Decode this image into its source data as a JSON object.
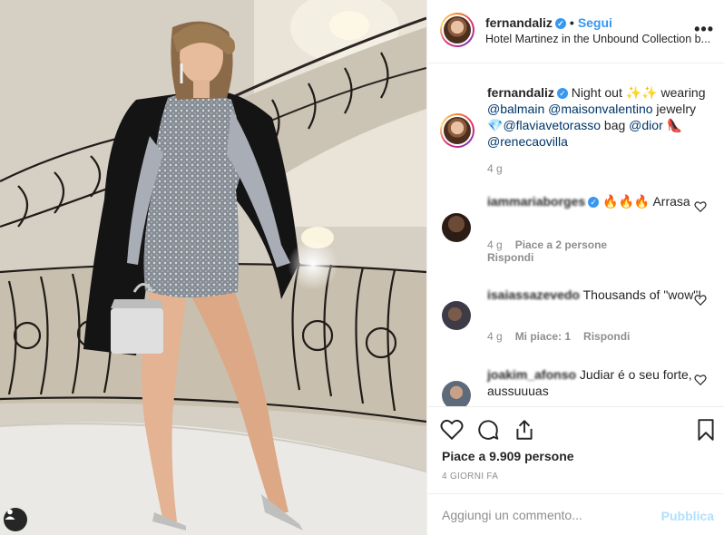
{
  "post": {
    "author": "fernandaliz",
    "verified_icon": "verified-badge-icon",
    "follow_label": "Segui",
    "separator": "•",
    "location": "Hotel Martinez in the Unbound Collection b...",
    "more_icon": "more-options-icon",
    "more_label": "•••"
  },
  "caption": {
    "user": "fernandaliz",
    "segments": [
      {
        "text": " Night out ✨✨ wearing ",
        "type": "text"
      },
      {
        "text": "@balmain",
        "type": "mention"
      },
      {
        "text": " ",
        "type": "text"
      },
      {
        "text": "@maisonvalentino",
        "type": "mention"
      },
      {
        "text": " jewelry 💎",
        "type": "text"
      },
      {
        "text": "@flaviavetorasso",
        "type": "mention"
      },
      {
        "text": " bag ",
        "type": "text"
      },
      {
        "text": "@dior",
        "type": "mention"
      },
      {
        "text": " 👠 ",
        "type": "text"
      },
      {
        "text": "@renecaovilla",
        "type": "mention"
      }
    ],
    "age": "4 g"
  },
  "comments": [
    {
      "user": "iammariaborges",
      "verified": true,
      "text": " 🔥🔥🔥 Arrasa",
      "age": "4 g",
      "likes_label": "Piace a 2 persone",
      "reply_label": "Rispondi"
    },
    {
      "user": "isaiassazevedo",
      "verified": false,
      "text": " Thousands of \"wow\"!",
      "age": "4 g",
      "likes_label": "Mi piace: 1",
      "reply_label": "Rispondi"
    },
    {
      "user": "joakim_afonso",
      "verified": false,
      "text": " Judiar é o seu forte, aussuuuas",
      "age": "",
      "likes_label": "",
      "reply_label": ""
    }
  ],
  "actions": {
    "like_icon": "heart-icon",
    "comment_icon": "comment-bubble-icon",
    "share_icon": "share-icon",
    "save_icon": "bookmark-icon",
    "likes_text": "Piace a 9.909 persone",
    "timestamp": "4 GIORNI FA"
  },
  "composer": {
    "placeholder": "Aggiungi un commento...",
    "publish_label": "Pubblica"
  },
  "colors": {
    "link_blue": "#3897f0",
    "mention_blue": "#003569",
    "publish_disabled": "#b2dffc",
    "muted_gray": "#8e8e8e",
    "text": "#262626",
    "border": "#efefef"
  }
}
